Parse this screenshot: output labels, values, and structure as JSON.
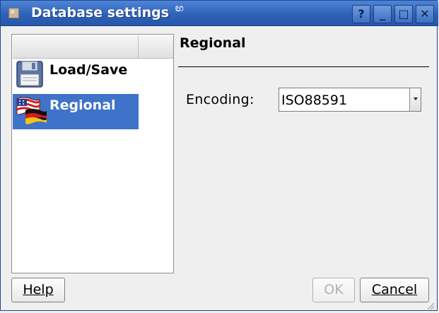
{
  "window": {
    "title": "Database settings",
    "title_controls": {
      "help": "?",
      "minimize": "_",
      "maximize": "□",
      "close": "✕"
    }
  },
  "sidebar": {
    "items": [
      {
        "label": "Load/Save",
        "icon": "floppy-disk-icon",
        "selected": false
      },
      {
        "label": "Regional",
        "icon": "flags-icon",
        "selected": true
      }
    ]
  },
  "panel": {
    "title": "Regional",
    "encoding_label": "Encoding:",
    "encoding_value": "ISO88591"
  },
  "buttons": {
    "help": "Help",
    "ok": "OK",
    "cancel": "Cancel"
  },
  "colors": {
    "titlebar": "#2f61b6",
    "selection": "#3f72c9",
    "background": "#efefef"
  }
}
